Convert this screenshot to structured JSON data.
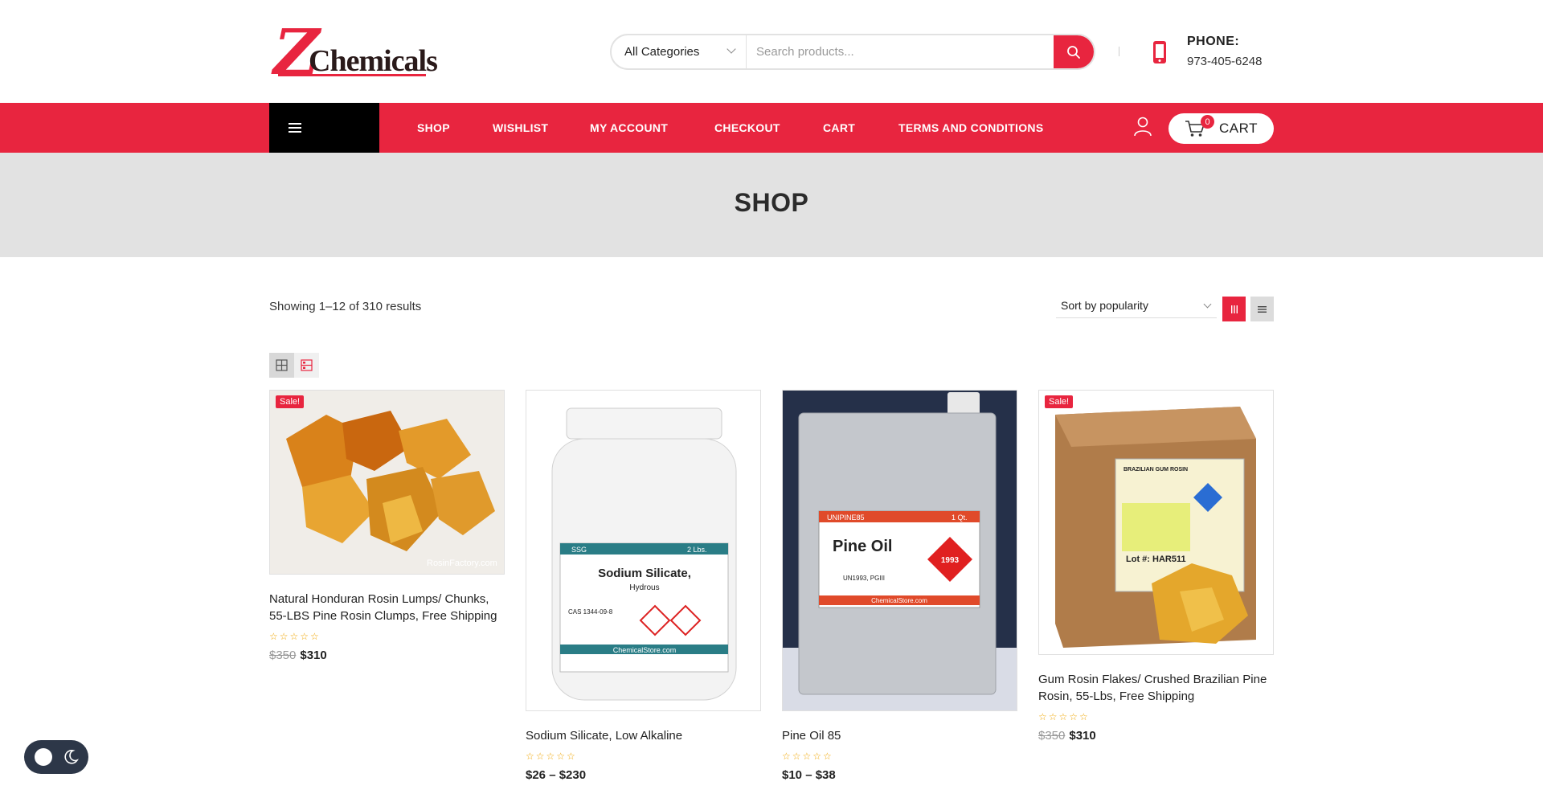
{
  "header": {
    "logo": {
      "letter": "Z",
      "word": "Chemicals"
    },
    "search": {
      "category_label": "All Categories",
      "placeholder": "Search products..."
    },
    "phone": {
      "label": "PHONE:",
      "number": "973-405-6248"
    }
  },
  "nav": {
    "items": [
      "SHOP",
      "WISHLIST",
      "MY ACCOUNT",
      "CHECKOUT",
      "CART",
      "TERMS AND CONDITIONS"
    ],
    "cart": {
      "label": "CART",
      "count": "0"
    }
  },
  "banner": {
    "title": "SHOP"
  },
  "toolbar": {
    "result_count": "Showing 1–12 of 310 results",
    "sort_label": "Sort by popularity"
  },
  "products": [
    {
      "name": "Natural Honduran Rosin Lumps/ Chunks, 55-LBS Pine Rosin Clumps, Free Shipping",
      "badge": "Sale!",
      "old_price": "$350",
      "price": "$310",
      "stars": "☆☆☆☆☆",
      "image_caption": "RosinFactory.com"
    },
    {
      "name": "Sodium Silicate, Low Alkaline",
      "badge": "",
      "old_price": "",
      "price": "$26 – $230",
      "stars": "☆☆☆☆☆",
      "label_title": "Sodium Silicate,",
      "label_sub": "Hydrous",
      "label_brand": "SSG",
      "label_weight": "2 Lbs.",
      "label_cas": "CAS 1344-09-8",
      "label_store": "ChemicalStore.com"
    },
    {
      "name": "Pine Oil 85",
      "badge": "",
      "old_price": "",
      "price": "$10 – $38",
      "stars": "☆☆☆☆☆",
      "label_title": "Pine Oil",
      "label_brand": "UNIPINE85",
      "label_size": "1 Qt.",
      "label_un": "UN1993, PGIII",
      "label_diamond": "1993",
      "label_store": "ChemicalStore.com"
    },
    {
      "name": "Gum Rosin Flakes/ Crushed Brazilian Pine Rosin, 55-Lbs, Free Shipping",
      "badge": "Sale!",
      "old_price": "$350",
      "price": "$310",
      "stars": "☆☆☆☆☆",
      "label_title": "BRAZILIAN GUM ROSIN",
      "label_lot": "Lot #: HAR511"
    }
  ],
  "colors": {
    "accent": "#e8253f",
    "nav_dark": "#000000",
    "banner_bg": "#e2e2e2",
    "star": "#f0a500"
  }
}
